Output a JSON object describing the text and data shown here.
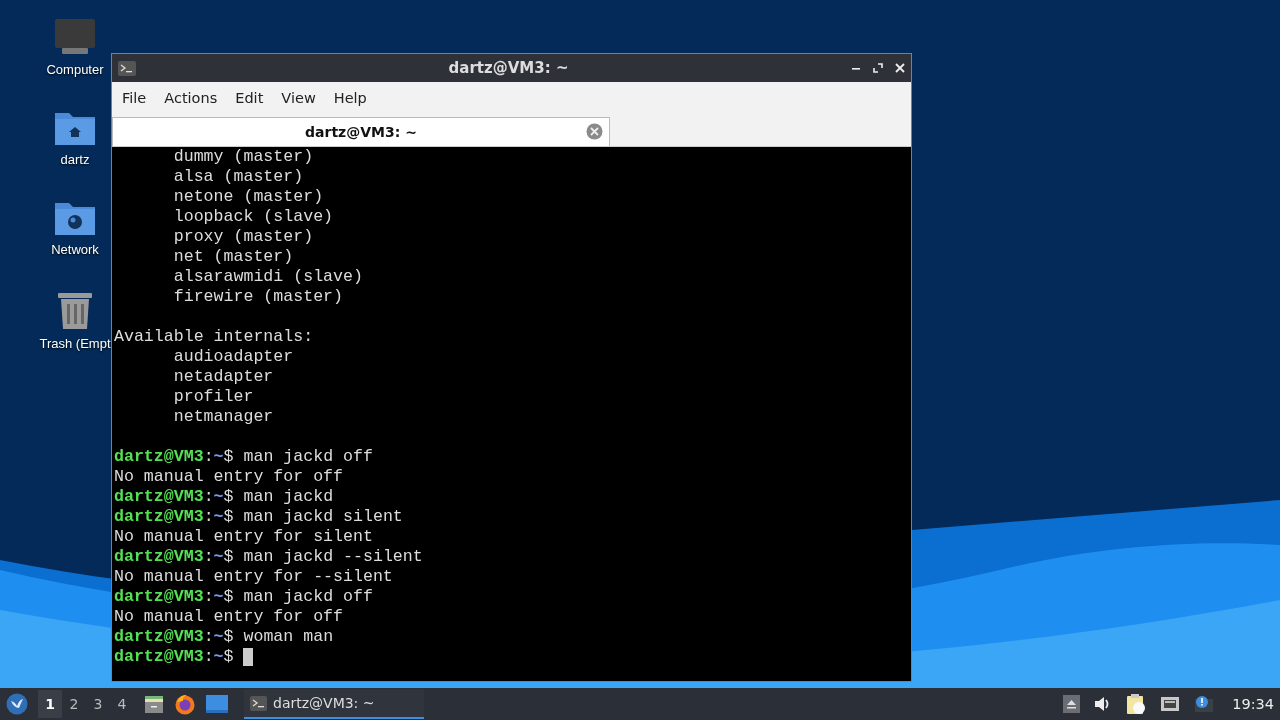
{
  "desktop_icons": [
    {
      "kind": "computer",
      "label": "Computer"
    },
    {
      "kind": "home",
      "label": "dartz"
    },
    {
      "kind": "network",
      "label": "Network"
    },
    {
      "kind": "trash",
      "label": "Trash (Empt"
    }
  ],
  "window": {
    "title": "dartz@VM3: ~",
    "menu": [
      "File",
      "Actions",
      "Edit",
      "View",
      "Help"
    ],
    "tabs": [
      {
        "label": "dartz@VM3: ~",
        "selected": true
      }
    ],
    "terminal": {
      "lines": [
        {
          "kind": "text",
          "text": "      dummy (master)"
        },
        {
          "kind": "text",
          "text": "      alsa (master)"
        },
        {
          "kind": "text",
          "text": "      netone (master)"
        },
        {
          "kind": "text",
          "text": "      loopback (slave)"
        },
        {
          "kind": "text",
          "text": "      proxy (master)"
        },
        {
          "kind": "text",
          "text": "      net (master)"
        },
        {
          "kind": "text",
          "text": "      alsarawmidi (slave)"
        },
        {
          "kind": "text",
          "text": "      firewire (master)"
        },
        {
          "kind": "blank"
        },
        {
          "kind": "text",
          "text": "Available internals:"
        },
        {
          "kind": "text",
          "text": "      audioadapter"
        },
        {
          "kind": "text",
          "text": "      netadapter"
        },
        {
          "kind": "text",
          "text": "      profiler"
        },
        {
          "kind": "text",
          "text": "      netmanager"
        },
        {
          "kind": "blank"
        },
        {
          "kind": "prompt",
          "user": "dartz@VM3",
          "sep": ":",
          "path": "~",
          "symbol": "$",
          "command": "man jackd off",
          "cursor": false
        },
        {
          "kind": "text",
          "text": "No manual entry for off"
        },
        {
          "kind": "prompt",
          "user": "dartz@VM3",
          "sep": ":",
          "path": "~",
          "symbol": "$",
          "command": "man jackd",
          "cursor": false
        },
        {
          "kind": "prompt",
          "user": "dartz@VM3",
          "sep": ":",
          "path": "~",
          "symbol": "$",
          "command": "man jackd silent",
          "cursor": false
        },
        {
          "kind": "text",
          "text": "No manual entry for silent"
        },
        {
          "kind": "prompt",
          "user": "dartz@VM3",
          "sep": ":",
          "path": "~",
          "symbol": "$",
          "command": "man jackd --silent",
          "cursor": false
        },
        {
          "kind": "text",
          "text": "No manual entry for --silent"
        },
        {
          "kind": "prompt",
          "user": "dartz@VM3",
          "sep": ":",
          "path": "~",
          "symbol": "$",
          "command": "man jackd off",
          "cursor": false
        },
        {
          "kind": "text",
          "text": "No manual entry for off"
        },
        {
          "kind": "prompt",
          "user": "dartz@VM3",
          "sep": ":",
          "path": "~",
          "symbol": "$",
          "command": "woman man",
          "cursor": false
        },
        {
          "kind": "prompt",
          "user": "dartz@VM3",
          "sep": ":",
          "path": "~",
          "symbol": "$",
          "cursor": true
        }
      ]
    }
  },
  "taskbar": {
    "workspaces": [
      {
        "label": "1",
        "selected": true
      },
      {
        "label": "2",
        "selected": false
      },
      {
        "label": "3",
        "selected": false
      },
      {
        "label": "4",
        "selected": false
      }
    ],
    "launchers": [
      {
        "kind": "files"
      },
      {
        "kind": "browser"
      },
      {
        "kind": "desktop"
      }
    ],
    "tasks": [
      {
        "label": "dartz@VM3: ~",
        "selected": true
      }
    ],
    "tray": [
      {
        "kind": "eject"
      },
      {
        "kind": "volume"
      },
      {
        "kind": "clipboard"
      },
      {
        "kind": "network"
      },
      {
        "kind": "notification"
      }
    ],
    "clock": "19:34"
  }
}
